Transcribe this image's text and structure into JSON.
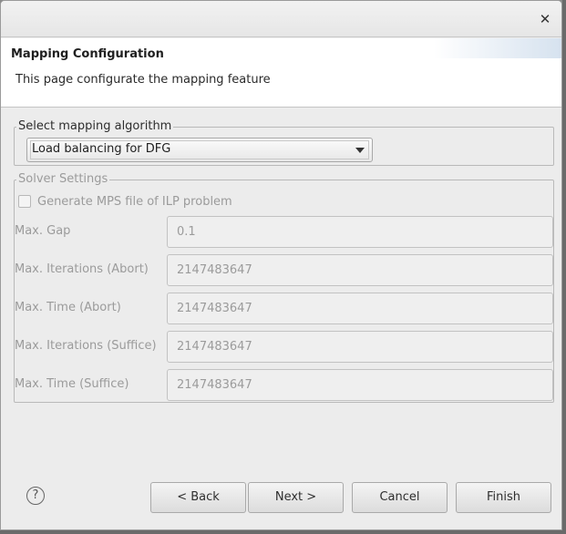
{
  "window": {
    "close_glyph": "✕"
  },
  "header": {
    "title": "Mapping Configuration",
    "description": "This page configurate the mapping feature"
  },
  "algorithm": {
    "legend": "Select mapping algorithm",
    "selected": "Load balancing for DFG"
  },
  "solver": {
    "legend": "Solver Settings",
    "checkbox_label": "Generate MPS file of ILP problem",
    "checkbox_checked": false,
    "fields": [
      {
        "label": "Max. Gap",
        "value": "0.1"
      },
      {
        "label": "Max. Iterations (Abort)",
        "value": "2147483647"
      },
      {
        "label": "Max. Time (Abort)",
        "value": "2147483647"
      },
      {
        "label": "Max. Iterations (Suffice)",
        "value": "2147483647"
      },
      {
        "label": "Max. Time (Suffice)",
        "value": "2147483647"
      }
    ]
  },
  "buttons": {
    "help_glyph": "?",
    "back": "< Back",
    "next": "Next >",
    "cancel": "Cancel",
    "finish": "Finish"
  }
}
